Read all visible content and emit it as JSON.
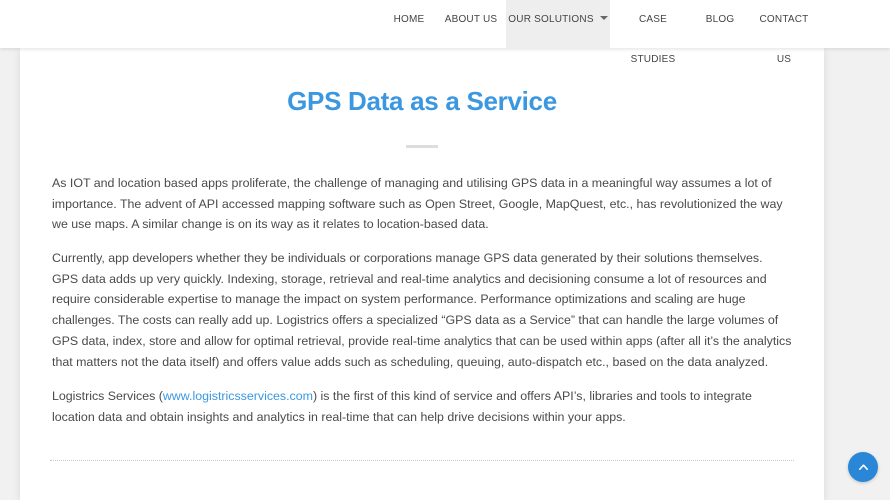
{
  "nav": {
    "items": [
      {
        "label": "HOME"
      },
      {
        "label": "ABOUT US"
      },
      {
        "label": "OUR SOLUTIONS",
        "active": true,
        "has_dropdown": true
      },
      {
        "label": "CASE STUDIES"
      },
      {
        "label": "BLOG"
      },
      {
        "label": "CONTACT US"
      }
    ]
  },
  "page": {
    "title": "GPS Data as a Service",
    "paragraphs": [
      "As IOT and location based apps proliferate, the challenge of managing and utilising GPS data in a meaningful way assumes a lot of importance. The advent of API accessed mapping software such as Open Street, Google, MapQuest, etc., has revolutionized the way we use maps. A similar change is on its way as it relates to location-based data.",
      "Currently, app developers whether they be individuals or corporations manage GPS data generated by their solutions themselves. GPS data adds up very quickly. Indexing, storage, retrieval and real-time analytics and decisioning consume a lot of resources and require considerable expertise to manage the impact on system performance. Performance optimizations and scaling are huge challenges. The costs can really add up. Logistrics offers a specialized “GPS data as a Service” that can handle the large volumes of GPS data, index, store and allow for optimal retrieval, provide real-time analytics that can be used within apps (after all it’s the analytics that matters not the data itself) and offers value adds such as scheduling, queuing, auto-dispatch etc., based on the data analyzed."
    ],
    "p3_before": "Logistrics Services (",
    "p3_link": "www.logistricsservices.com",
    "p3_after": ") is the first of this kind of service and offers API’s, libraries and tools to integrate location data and obtain insights and analytics in real-time that can help drive decisions within your apps."
  },
  "colors": {
    "accent": "#3a97e0",
    "scroll_button": "#2a86d6"
  },
  "icons": {
    "dropdown": "caret-down-icon",
    "scroll_top": "arrow-up-icon"
  }
}
